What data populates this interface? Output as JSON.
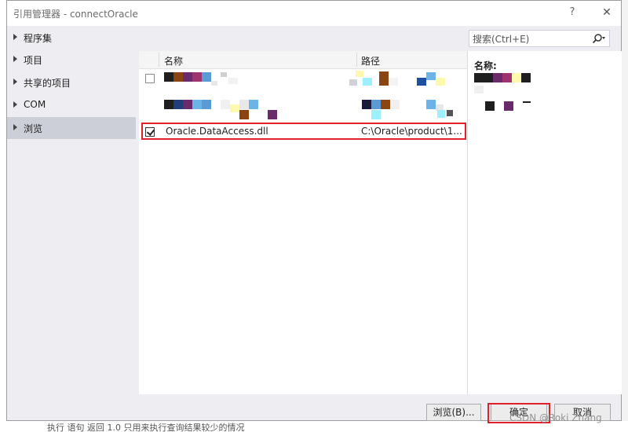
{
  "window": {
    "title": "引用管理器 - connectOracle",
    "help_label": "?",
    "close_label": "✕"
  },
  "sidebar": {
    "items": [
      {
        "label": "程序集",
        "selected": false
      },
      {
        "label": "项目",
        "selected": false
      },
      {
        "label": "共享的项目",
        "selected": false
      },
      {
        "label": "COM",
        "selected": false
      },
      {
        "label": "浏览",
        "selected": true
      }
    ]
  },
  "search": {
    "placeholder": "搜索(Ctrl+E)",
    "icon": "search-icon"
  },
  "table": {
    "columns": [
      "名称",
      "路径"
    ],
    "rows": [
      {
        "name": "",
        "path": "",
        "checked": false,
        "obscured": true
      },
      {
        "name": "",
        "path": "",
        "checked": false,
        "obscured": true
      },
      {
        "name": "Oracle.DataAccess.dll",
        "path": "C:\\Oracle\\product\\1...",
        "checked": true,
        "obscured": false
      }
    ]
  },
  "detail": {
    "name_label": "名称:"
  },
  "buttons": {
    "browse": "浏览(B)...",
    "ok": "确定",
    "cancel": "取消"
  },
  "background": {
    "bottom_text": "执行 语句 返回 1.0 只用来执行查询结果较少的情况"
  },
  "watermark": "CSDN @Roki Zhang",
  "colors": {
    "highlight": "#e0202a",
    "selected_sidebar": "#ccced8",
    "dialog_bg": "#eeeef2"
  }
}
